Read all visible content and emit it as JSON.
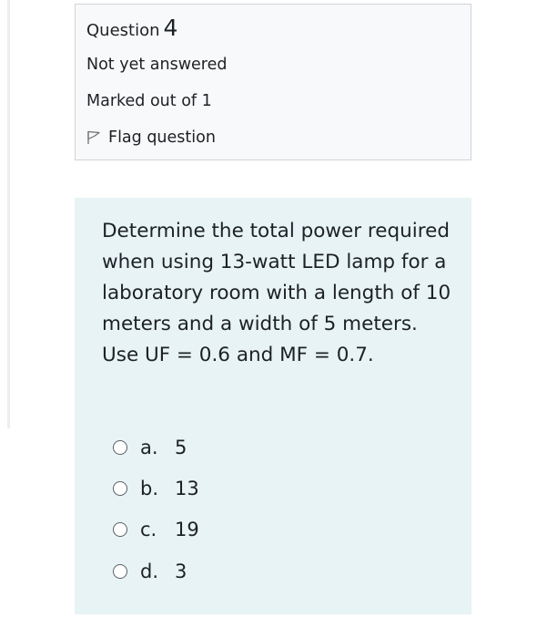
{
  "question_info": {
    "label": "Question",
    "number": "4",
    "status": "Not yet answered",
    "marks": "Marked out of 1",
    "flag_label": "Flag question"
  },
  "question": {
    "text": "Determine the total power required when using 13-watt LED lamp for a laboratory room with a length of 10 meters and a width of 5 meters. Use UF = 0.6 and MF = 0.7."
  },
  "answers": [
    {
      "letter": "a.",
      "value": "5"
    },
    {
      "letter": "b.",
      "value": "13"
    },
    {
      "letter": "c.",
      "value": "19"
    },
    {
      "letter": "d.",
      "value": "3"
    }
  ],
  "colors": {
    "info_background": "#f8f9fa",
    "info_border": "#cfd4d9",
    "formulation_background": "#e7f3f5",
    "text": "#1d2125"
  }
}
